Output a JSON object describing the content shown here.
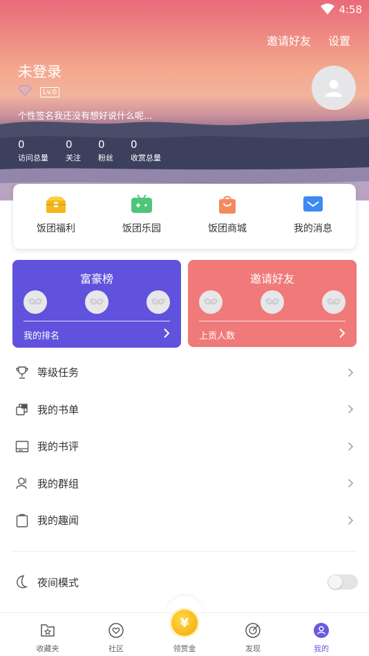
{
  "status": {
    "time": "4:58"
  },
  "header": {
    "invite_label": "邀请好友",
    "settings_label": "设置",
    "username": "未登录",
    "level": "Lv.0",
    "signature": "个性签名我还没有想好说什么呢...",
    "stats": [
      {
        "value": "0",
        "label": "访问总量"
      },
      {
        "value": "0",
        "label": "关注"
      },
      {
        "value": "0",
        "label": "粉丝"
      },
      {
        "value": "0",
        "label": "收赏总量"
      }
    ]
  },
  "quick": [
    {
      "label": "饭团福利",
      "icon": "treasure-chest-icon",
      "color": "#f5b81c"
    },
    {
      "label": "饭团乐园",
      "icon": "gamepad-icon",
      "color": "#4fc57a"
    },
    {
      "label": "饭团商城",
      "icon": "shopping-bag-icon",
      "color": "#f4895c"
    },
    {
      "label": "我的消息",
      "icon": "mail-icon",
      "color": "#3d8af2"
    }
  ],
  "rank_cards": {
    "left": {
      "title": "富豪榜",
      "footer": "我的排名",
      "color": "#6152dd"
    },
    "right": {
      "title": "邀请好友",
      "footer": "上贡人数",
      "color": "#f07a79"
    }
  },
  "menu": [
    {
      "label": "等级任务",
      "icon": "trophy-icon"
    },
    {
      "label": "我的书单",
      "icon": "book-list-icon"
    },
    {
      "label": "我的书评",
      "icon": "review-icon"
    },
    {
      "label": "我的群组",
      "icon": "group-icon"
    },
    {
      "label": "我的趣闻",
      "icon": "clipboard-icon"
    }
  ],
  "night_mode": {
    "label": "夜间模式",
    "enabled": false
  },
  "nav": [
    {
      "label": "收藏夹",
      "icon": "favorites-icon"
    },
    {
      "label": "社区",
      "icon": "community-icon"
    },
    {
      "label": "领赏金",
      "icon": "coin-icon"
    },
    {
      "label": "发现",
      "icon": "discover-icon"
    },
    {
      "label": "我的",
      "icon": "profile-icon",
      "active": true
    }
  ],
  "colors": {
    "accent": "#6a5ae0"
  }
}
